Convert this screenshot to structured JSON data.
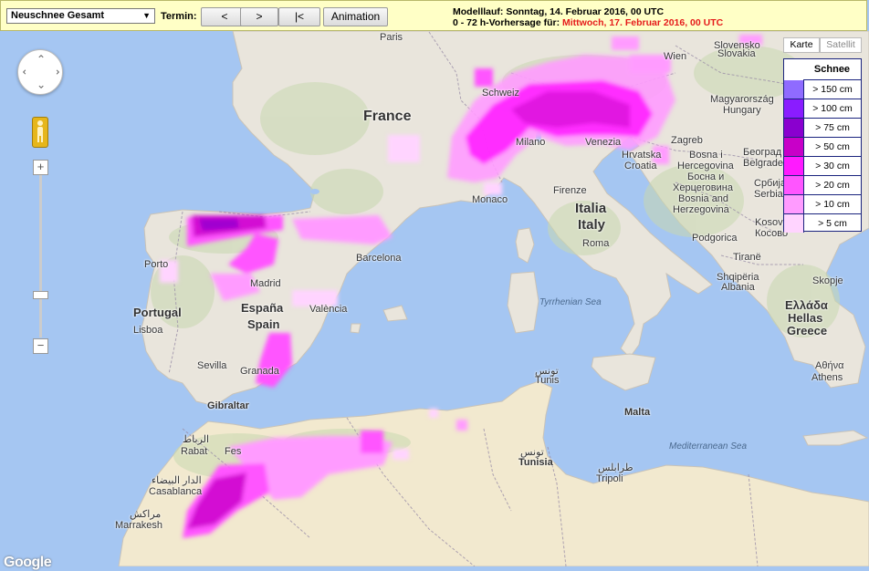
{
  "toolbar": {
    "product_select": "Neuschnee Gesamt",
    "termin_label": "Termin:",
    "btn_prev": "<",
    "btn_next": ">",
    "btn_first": "|<",
    "btn_animation": "Animation",
    "run_line1": "Modelllauf: Sonntag, 14. Februar 2016, 00 UTC",
    "run_line2_prefix": "0 - 72 h-Vorhersage für:",
    "run_line2_date": "Mittwoch, 17. Februar 2016, 00 UTC"
  },
  "map_type": {
    "map": "Karte",
    "satellite": "Satellit"
  },
  "zoom": {
    "in": "+",
    "out": "−"
  },
  "legend": {
    "title": "Schnee",
    "items": [
      {
        "label": "> 150 cm",
        "color": "#8f6bff"
      },
      {
        "label": "> 100 cm",
        "color": "#8a1cff"
      },
      {
        "label": "> 75 cm",
        "color": "#8a00cf"
      },
      {
        "label": "> 50 cm",
        "color": "#c800c8"
      },
      {
        "label": "> 30 cm",
        "color": "#ff1aff"
      },
      {
        "label": "> 20 cm",
        "color": "#ff55ff"
      },
      {
        "label": "> 10 cm",
        "color": "#ff9bff"
      },
      {
        "label": "> 5 cm",
        "color": "#ffd4ff"
      }
    ]
  },
  "labels": {
    "france": "France",
    "paris": "Paris",
    "espana": "España",
    "spain": "Spain",
    "portugal": "Portugal",
    "lisboa": "Lisboa",
    "porto": "Porto",
    "madrid": "Madrid",
    "barcelona": "Barcelona",
    "valencia": "València",
    "sevilla": "Sevilla",
    "granada": "Granada",
    "gibraltar": "Gibraltar",
    "italia": "Italia",
    "italy": "Italy",
    "roma": "Roma",
    "firenze": "Firenze",
    "venezia": "Venezia",
    "monaco": "Monaco",
    "schweiz": "Schweiz",
    "milano": "Milano",
    "tyrrhenian": "Tyrrhenian Sea",
    "mediterranean": "Mediterranean Sea",
    "malta": "Malta",
    "tunis_ar": "تونس",
    "tunis": "Tunis",
    "tunisia_ar": "تونس",
    "tunisia": "Tunisia",
    "tripoli_ar": "طرابلس",
    "tripoli": "Tripoli",
    "rabat_ar": "الرباط",
    "rabat": "Rabat",
    "fes": "Fes",
    "casablanca_ar": "الدار البيضاء",
    "casablanca": "Casablanca",
    "marrakesh_ar": "مراكش",
    "marrakesh": "Marrakesh",
    "wien": "Wien",
    "slovakia": "Slovakia",
    "slovensko": "Slovensko",
    "magyarorszag": "Magyarország",
    "hungary": "Hungary",
    "zagreb": "Zagreb",
    "hrvatska": "Hrvatska",
    "croatia": "Croatia",
    "bosna": "Bosna i",
    "hercegovina": "Hercegovina",
    "bosna_cyr": "Босна и",
    "herc_cyr": "Херцеговина",
    "bosnia_and": "Bosnia and",
    "herzegovina": "Herzegovina",
    "beograd_cyr": "Београд",
    "beograd": "Belgrade",
    "srbija": "Србија",
    "serbia": "Serbia",
    "kosovo": "Kosovo",
    "kosovo_cyr": "Косово",
    "podgorica": "Podgorica",
    "tirane": "Tiranë",
    "shqiperia": "Shqipëria",
    "albania": "Albania",
    "ellada": "Ελλάδα",
    "hellas": "Hellas",
    "greece": "Greece",
    "athina": "Αθήνα",
    "athens": "Athens",
    "skopje": "Skopje",
    "google": "Google"
  }
}
